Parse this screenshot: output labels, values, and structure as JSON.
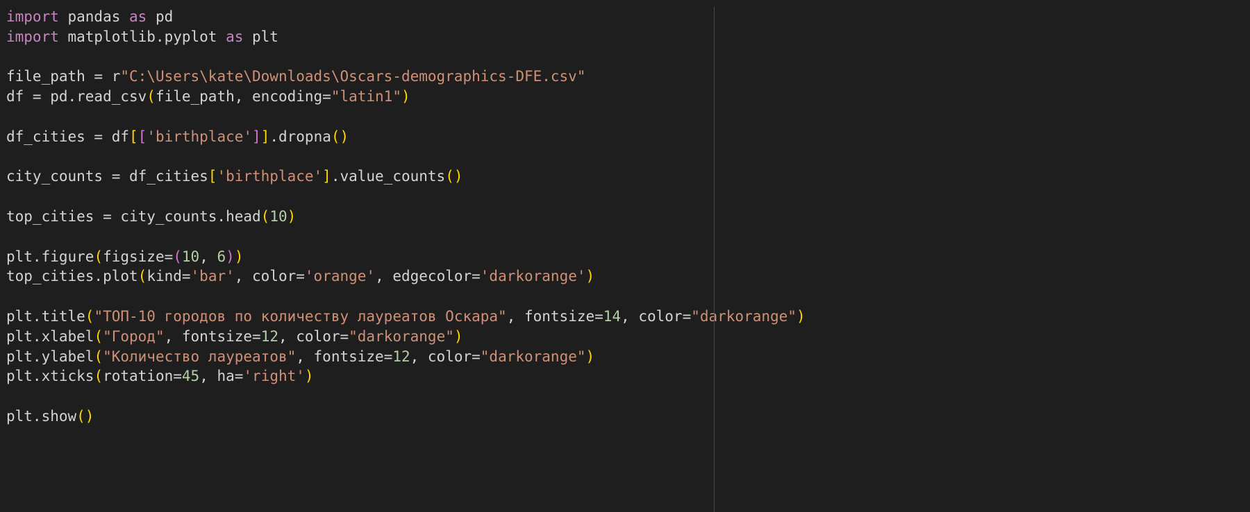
{
  "colors": {
    "background": "#1e1e1e",
    "keyword": "#c586c0",
    "identifier": "#d4d4d4",
    "string": "#ce9178",
    "number": "#b5cea8",
    "bracket_outer": "#ffd700",
    "bracket_inner": "#da70d6"
  },
  "lines": [
    [
      {
        "c": "kw",
        "t": "import"
      },
      {
        "c": "id",
        "t": " pandas "
      },
      {
        "c": "kw",
        "t": "as"
      },
      {
        "c": "id",
        "t": " pd"
      }
    ],
    [
      {
        "c": "kw",
        "t": "import"
      },
      {
        "c": "id",
        "t": " matplotlib.pyplot "
      },
      {
        "c": "kw",
        "t": "as"
      },
      {
        "c": "id",
        "t": " plt"
      }
    ],
    [],
    [
      {
        "c": "id",
        "t": "file_path = r"
      },
      {
        "c": "str",
        "t": "\"C:\\Users\\kate\\Downloads\\Oscars-demographics-DFE.csv\""
      }
    ],
    [
      {
        "c": "id",
        "t": "df = pd.read_csv"
      },
      {
        "c": "p1",
        "t": "("
      },
      {
        "c": "id",
        "t": "file_path, encoding="
      },
      {
        "c": "str",
        "t": "\"latin1\""
      },
      {
        "c": "p1",
        "t": ")"
      }
    ],
    [],
    [
      {
        "c": "id",
        "t": "df_cities = df"
      },
      {
        "c": "p1",
        "t": "["
      },
      {
        "c": "p2",
        "t": "["
      },
      {
        "c": "str",
        "t": "'birthplace'"
      },
      {
        "c": "p2",
        "t": "]"
      },
      {
        "c": "p1",
        "t": "]"
      },
      {
        "c": "id",
        "t": ".dropna"
      },
      {
        "c": "p1",
        "t": "()"
      }
    ],
    [],
    [
      {
        "c": "id",
        "t": "city_counts = df_cities"
      },
      {
        "c": "p1",
        "t": "["
      },
      {
        "c": "str",
        "t": "'birthplace'"
      },
      {
        "c": "p1",
        "t": "]"
      },
      {
        "c": "id",
        "t": ".value_counts"
      },
      {
        "c": "p1",
        "t": "()"
      }
    ],
    [],
    [
      {
        "c": "id",
        "t": "top_cities = city_counts.head"
      },
      {
        "c": "p1",
        "t": "("
      },
      {
        "c": "num",
        "t": "10"
      },
      {
        "c": "p1",
        "t": ")"
      }
    ],
    [],
    [
      {
        "c": "id",
        "t": "plt.figure"
      },
      {
        "c": "p1",
        "t": "("
      },
      {
        "c": "id",
        "t": "figsize="
      },
      {
        "c": "p2",
        "t": "("
      },
      {
        "c": "num",
        "t": "10"
      },
      {
        "c": "id",
        "t": ", "
      },
      {
        "c": "num",
        "t": "6"
      },
      {
        "c": "p2",
        "t": ")"
      },
      {
        "c": "p1",
        "t": ")"
      }
    ],
    [
      {
        "c": "id",
        "t": "top_cities.plot"
      },
      {
        "c": "p1",
        "t": "("
      },
      {
        "c": "id",
        "t": "kind="
      },
      {
        "c": "str",
        "t": "'bar'"
      },
      {
        "c": "id",
        "t": ", color="
      },
      {
        "c": "str",
        "t": "'orange'"
      },
      {
        "c": "id",
        "t": ", edgecolor="
      },
      {
        "c": "str",
        "t": "'darkorange'"
      },
      {
        "c": "p1",
        "t": ")"
      }
    ],
    [],
    [
      {
        "c": "id",
        "t": "plt.title"
      },
      {
        "c": "p1",
        "t": "("
      },
      {
        "c": "str",
        "t": "\"ТОП-10 городов по количеству лауреатов Оскара\""
      },
      {
        "c": "id",
        "t": ", fontsize="
      },
      {
        "c": "num",
        "t": "14"
      },
      {
        "c": "id",
        "t": ", color="
      },
      {
        "c": "str",
        "t": "\"darkorange\""
      },
      {
        "c": "p1",
        "t": ")"
      }
    ],
    [
      {
        "c": "id",
        "t": "plt.xlabel"
      },
      {
        "c": "p1",
        "t": "("
      },
      {
        "c": "str",
        "t": "\"Город\""
      },
      {
        "c": "id",
        "t": ", fontsize="
      },
      {
        "c": "num",
        "t": "12"
      },
      {
        "c": "id",
        "t": ", color="
      },
      {
        "c": "str",
        "t": "\"darkorange\""
      },
      {
        "c": "p1",
        "t": ")"
      }
    ],
    [
      {
        "c": "id",
        "t": "plt.ylabel"
      },
      {
        "c": "p1",
        "t": "("
      },
      {
        "c": "str",
        "t": "\"Количество лауреатов\""
      },
      {
        "c": "id",
        "t": ", fontsize="
      },
      {
        "c": "num",
        "t": "12"
      },
      {
        "c": "id",
        "t": ", color="
      },
      {
        "c": "str",
        "t": "\"darkorange\""
      },
      {
        "c": "p1",
        "t": ")"
      }
    ],
    [
      {
        "c": "id",
        "t": "plt.xticks"
      },
      {
        "c": "p1",
        "t": "("
      },
      {
        "c": "id",
        "t": "rotation="
      },
      {
        "c": "num",
        "t": "45"
      },
      {
        "c": "id",
        "t": ", ha="
      },
      {
        "c": "str",
        "t": "'right'"
      },
      {
        "c": "p1",
        "t": ")"
      }
    ],
    [],
    [
      {
        "c": "id",
        "t": "plt.show"
      },
      {
        "c": "p1",
        "t": "()"
      }
    ]
  ]
}
